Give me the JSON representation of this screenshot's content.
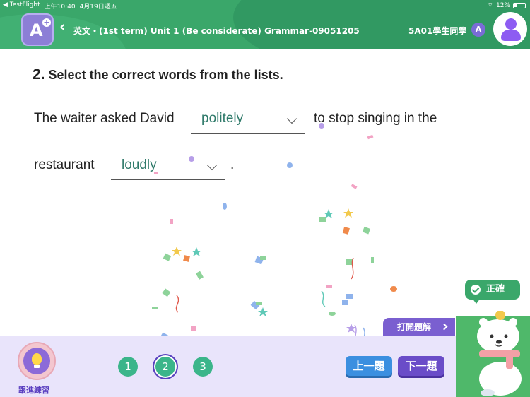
{
  "status_bar": {
    "carrier": "◀ TestFlight",
    "time": "上午10:40",
    "date": "4月19日週五",
    "battery": "12%"
  },
  "header": {
    "title": "英文・(1st term) Unit 1 (Be considerate)  Grammar-09051205",
    "user": "5A01學生同學",
    "level_badge": "A"
  },
  "question": {
    "number": "2.",
    "instruction": "Select the correct words from the lists.",
    "part1": "The waiter asked David",
    "dropdown1_value": "politely",
    "part2": "to stop singing in the",
    "part3": "restaurant",
    "dropdown2_value": "loudly",
    "part4": "."
  },
  "footer": {
    "practice_label": "跟進練習",
    "question_numbers": [
      "1",
      "2",
      "3"
    ],
    "current_question": "2",
    "prev_label": "上一題",
    "next_label": "下一題",
    "solution_label": "打開題解"
  },
  "feedback": {
    "correct_label": "正確"
  },
  "colors": {
    "header": "#3aa76a",
    "accent_purple": "#6a4cc8",
    "accent_blue": "#3b8fe0",
    "answer_text": "#2f7a6a"
  }
}
